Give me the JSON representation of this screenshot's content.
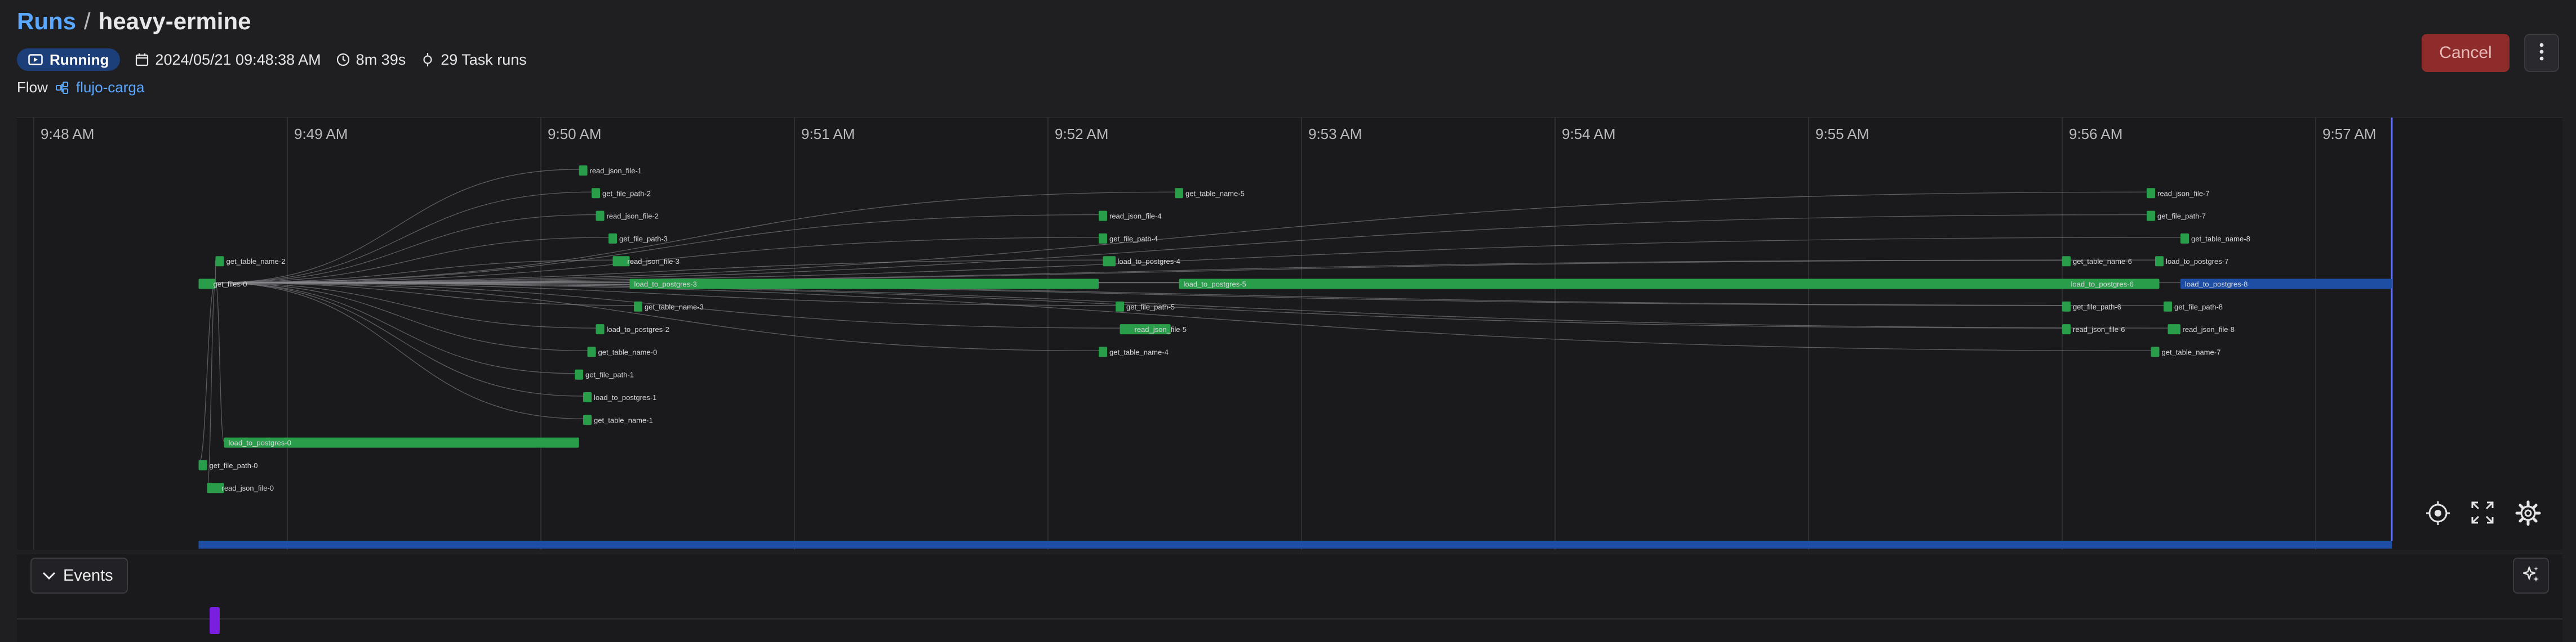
{
  "header": {
    "breadcrumb_root": "Runs",
    "breadcrumb_sep": "/",
    "run_name": "heavy-ermine",
    "status": "Running",
    "start_time": "2024/05/21 09:48:38 AM",
    "duration": "8m 39s",
    "task_runs": "29 Task runs",
    "flow_label": "Flow",
    "flow_name": "flujo-carga",
    "cancel_label": "Cancel"
  },
  "colors": {
    "accent": "#5aa7ff",
    "status_running": "#1c3f7a",
    "cancel": "#8e2b2b",
    "task_completed": "#2a9d4b",
    "task_running": "#1d4ea3",
    "event_marker": "#7a1fe0"
  },
  "icons": {
    "status": "play-icon",
    "date": "calendar-icon",
    "duration": "clock-icon",
    "task_runs": "task-run-icon",
    "flow": "flow-icon",
    "more": "kebab-menu-icon",
    "recenter": "crosshair-icon",
    "fullscreen": "expand-icon",
    "settings": "gear-icon",
    "events_toggle": "chevron-down-icon",
    "sparkle": "sparkle-icon"
  },
  "timeline": {
    "ticks": [
      "9:48 AM",
      "9:49 AM",
      "9:50 AM",
      "9:51 AM",
      "9:52 AM",
      "9:53 AM",
      "9:54 AM",
      "9:55 AM",
      "9:56 AM",
      "9:57 AM"
    ],
    "tasks": [
      {
        "name": "get_files-0",
        "state": "completed",
        "start": "9:48:39",
        "end": "9:48:43",
        "row": 5
      },
      {
        "name": "get_table_name-2",
        "state": "completed",
        "start": "9:48:43",
        "end": "9:48:45",
        "row": 4
      },
      {
        "name": "load_to_postgres-0",
        "state": "completed",
        "start": "9:48:45",
        "end": "9:50:09",
        "row": 12
      },
      {
        "name": "get_file_path-0",
        "state": "completed",
        "start": "9:48:39",
        "end": "9:48:41",
        "row": 13
      },
      {
        "name": "read_json_file-0",
        "state": "completed",
        "start": "9:48:41",
        "end": "9:48:45",
        "row": 14
      },
      {
        "name": "read_json_file-1",
        "state": "completed",
        "start": "9:50:09",
        "end": "9:50:11",
        "row": 0
      },
      {
        "name": "get_file_path-2",
        "state": "completed",
        "start": "9:50:12",
        "end": "9:50:14",
        "row": 1
      },
      {
        "name": "read_json_file-2",
        "state": "completed",
        "start": "9:50:13",
        "end": "9:50:15",
        "row": 2
      },
      {
        "name": "get_file_path-3",
        "state": "completed",
        "start": "9:50:16",
        "end": "9:50:18",
        "row": 3
      },
      {
        "name": "read_json_file-3",
        "state": "completed",
        "start": "9:50:17",
        "end": "9:50:21",
        "row": 4
      },
      {
        "name": "load_to_postgres-3",
        "state": "completed",
        "start": "9:50:21",
        "end": "9:52:12",
        "row": 5
      },
      {
        "name": "get_table_name-3",
        "state": "completed",
        "start": "9:50:22",
        "end": "9:50:24",
        "row": 6
      },
      {
        "name": "load_to_postgres-2",
        "state": "completed",
        "start": "9:50:13",
        "end": "9:50:15",
        "row": 7
      },
      {
        "name": "get_table_name-0",
        "state": "completed",
        "start": "9:50:11",
        "end": "9:50:13",
        "row": 8
      },
      {
        "name": "get_file_path-1",
        "state": "completed",
        "start": "9:50:08",
        "end": "9:50:10",
        "row": 9
      },
      {
        "name": "load_to_postgres-1",
        "state": "completed",
        "start": "9:50:10",
        "end": "9:50:12",
        "row": 10
      },
      {
        "name": "get_table_name-1",
        "state": "completed",
        "start": "9:50:10",
        "end": "9:50:12",
        "row": 11
      },
      {
        "name": "get_table_name-5",
        "state": "completed",
        "start": "9:52:30",
        "end": "9:52:32",
        "row": 1
      },
      {
        "name": "read_json_file-4",
        "state": "completed",
        "start": "9:52:12",
        "end": "9:52:14",
        "row": 2
      },
      {
        "name": "get_file_path-4",
        "state": "completed",
        "start": "9:52:12",
        "end": "9:52:14",
        "row": 3
      },
      {
        "name": "load_to_postgres-4",
        "state": "completed",
        "start": "9:52:13",
        "end": "9:52:16",
        "row": 4
      },
      {
        "name": "load_to_postgres-5",
        "state": "completed",
        "start": "9:52:31",
        "end": "9:56:23",
        "row": 5
      },
      {
        "name": "get_file_path-5",
        "state": "completed",
        "start": "9:52:16",
        "end": "9:52:18",
        "row": 6
      },
      {
        "name": "read_json_file-5",
        "state": "completed",
        "start": "9:52:17",
        "end": "9:52:29",
        "row": 7
      },
      {
        "name": "get_table_name-4",
        "state": "completed",
        "start": "9:52:12",
        "end": "9:52:14",
        "row": 8
      },
      {
        "name": "read_json_file-7",
        "state": "completed",
        "start": "9:56:20",
        "end": "9:56:22",
        "row": 1
      },
      {
        "name": "get_file_path-7",
        "state": "completed",
        "start": "9:56:20",
        "end": "9:56:22",
        "row": 2
      },
      {
        "name": "get_table_name-8",
        "state": "completed",
        "start": "9:56:28",
        "end": "9:56:30",
        "row": 3
      },
      {
        "name": "get_table_name-6",
        "state": "completed",
        "start": "9:56:00",
        "end": "9:56:02",
        "row": 4
      },
      {
        "name": "load_to_postgres-7",
        "state": "completed",
        "start": "9:56:22",
        "end": "9:56:24",
        "row": 4
      },
      {
        "name": "load_to_postgres-6",
        "state": "completed",
        "start": "9:56:01",
        "end": "9:56:20",
        "row": 5
      },
      {
        "name": "load_to_postgres-8",
        "state": "running",
        "start": "9:56:28",
        "end": "9:57:18",
        "row": 5
      },
      {
        "name": "get_file_path-6",
        "state": "completed",
        "start": "9:56:00",
        "end": "9:56:02",
        "row": 6
      },
      {
        "name": "get_file_path-8",
        "state": "completed",
        "start": "9:56:24",
        "end": "9:56:26",
        "row": 6
      },
      {
        "name": "read_json_file-6",
        "state": "completed",
        "start": "9:56:00",
        "end": "9:56:02",
        "row": 7
      },
      {
        "name": "read_json_file-8",
        "state": "completed",
        "start": "9:56:25",
        "end": "9:56:28",
        "row": 7
      },
      {
        "name": "get_table_name-7",
        "state": "completed",
        "start": "9:56:21",
        "end": "9:56:23",
        "row": 8
      }
    ]
  },
  "events": {
    "toggle_label": "Events"
  }
}
